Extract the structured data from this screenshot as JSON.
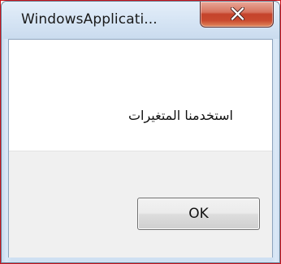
{
  "window": {
    "title": "WindowsApplicati...",
    "close_icon": "close-icon"
  },
  "dialog": {
    "message": "استخدمنا المتغيرات",
    "ok_label": "OK"
  },
  "colors": {
    "close_button": "#c94a2f",
    "frame": "#cfe0f2",
    "footer": "#f0f0f0",
    "highlight_border": "#c8141c"
  }
}
